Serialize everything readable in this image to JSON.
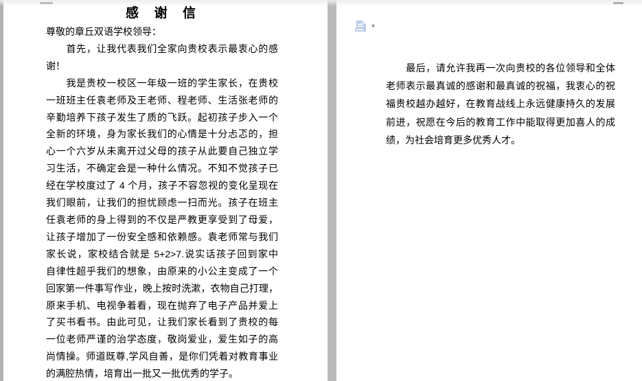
{
  "document": {
    "page1": {
      "title": "感  谢  信",
      "paragraphs": [
        {
          "lines": [
            "尊敬的章丘双语学校领导："
          ]
        },
        {
          "lines": [
            "　　首先，让我代表我们全家向贵校表示最衷心的感",
            "谢！"
          ]
        },
        {
          "lines": [
            "　　我是贵校一校区一年级一班的学生家长，在贵校",
            "一班班主任袁老师及王老师、程老师、生活张老师的",
            "辛勤培养下孩子发生了质的飞跃。起初孩子步入一个",
            "全新的环境，身为家长我们的心情是十分忐忑的，担",
            "心一个六岁从未离开过父母的孩子从此要自己独立学",
            "习生活，不确定会是一种什么情况。不知不觉孩子已",
            "经在学校度过了 4 个月，孩子不容忽视的变化呈现在",
            "我们眼前，让我们的担忧顾虑一扫而光。孩子在班主",
            "任袁老师的身上得到的不仅是严教更享受到了母爱，",
            "让孩子增加了一份安全感和依赖感。袁老师常与我们",
            "家长说，家校结合就是 5+2>7.说实话孩子回到家中",
            "自律性超乎我们的想象，由原来的小公主变成了一个",
            "回家第一件事写作业，晚上按时洗漱，衣物自己打理，",
            "原来手机、电视争着看，现在抛弃了电子产品并爱上",
            "了买书看书。由此可见，让我们家长看到了贵校的每",
            "一位老师严谨的治学态度，敬岗爱业，爱生如子的高",
            "尚情操。师道既尊,学风自善，是你们凭着对教育事业",
            "的满腔热情，培育出一批又一批优秀的学子。"
          ]
        }
      ]
    },
    "page2": {
      "paragraphs": [
        {
          "lines": [
            "　　最后，请允许我再一次向贵校的各位领导和全体",
            "老师表示最真诚的感谢和最真诚的祝福，我衷心的祝",
            "福贵校越办越好，在教育战线上永远健康持久的发展",
            "前进，祝愿在今后的教育工作中能取得更加喜人的成",
            "绩，为社会培育更多优秀人才。"
          ]
        }
      ]
    },
    "paste_options": {
      "icon": "paste-options-icon",
      "dropdown_glyph": "▾"
    }
  },
  "colors": {
    "page_bg": "#ffffff",
    "gutter": "#b9b9b9",
    "left_strip": "#b1b1b1",
    "text": "#000000",
    "paste_icon_fill": "#b9cbe9",
    "paste_icon_fold": "#dbe5f4",
    "paste_icon_lines": "#ffffff",
    "dropdown_arrow": "#8f8f8f",
    "notch": "#bcbcbc"
  }
}
